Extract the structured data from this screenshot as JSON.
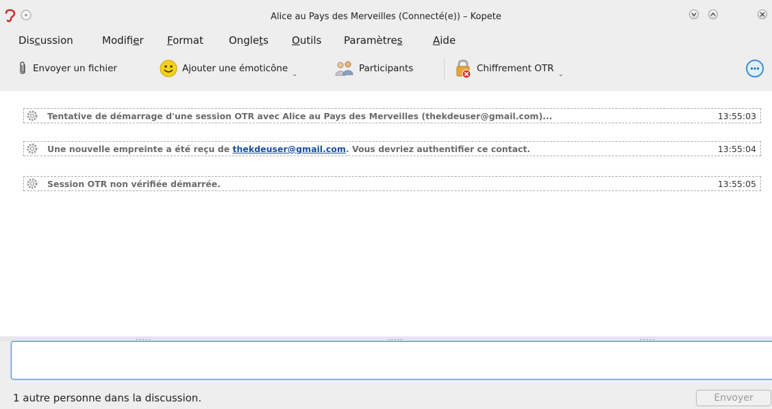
{
  "window": {
    "title": "Alice au Pays des Merveilles (Connecté(e)) – Kopete"
  },
  "menubar": {
    "items": [
      {
        "label": "Discussion",
        "mnemonic": "c"
      },
      {
        "label": "Modifier",
        "mnemonic": "e"
      },
      {
        "label": "Format",
        "mnemonic": "F"
      },
      {
        "label": "Onglets",
        "mnemonic": "t"
      },
      {
        "label": "Outils",
        "mnemonic": "O"
      },
      {
        "label": "Paramètres",
        "mnemonic": "s"
      },
      {
        "label": "Aide",
        "mnemonic": "A"
      }
    ]
  },
  "toolbar": {
    "send_file": "Envoyer un fichier",
    "add_emoticon": "Ajouter une émoticône",
    "participants": "Participants",
    "otr": "Chiffrement OTR"
  },
  "messages": [
    {
      "text": "Tentative de démarrage d'une session OTR avec Alice au Pays des Merveilles (thekdeuser@gmail.com)...",
      "time": "13:55:03"
    },
    {
      "text_before": "Une nouvelle empreinte a été reçu de ",
      "link": "thekdeuser@gmail.com",
      "text_after": ". Vous devriez authentifier ce contact.",
      "time": "13:55:04"
    },
    {
      "text": "Session OTR non vérifiée démarrée.",
      "time": "13:55:05"
    }
  ],
  "status": {
    "text": "1 autre personne dans la discussion.",
    "send_label": "Envoyer"
  },
  "icons": {
    "app": "kopete-ear-icon",
    "attach": "paperclip-icon",
    "emoticon": "smiley-icon",
    "participants": "participants-icon",
    "otr": "lock-icon",
    "chat": "chat-bubble-icon",
    "notice": "gear-icon"
  },
  "colors": {
    "link": "#1a4ea0",
    "input_border": "#4d8ed1",
    "app_icon": "#d22d2d"
  }
}
